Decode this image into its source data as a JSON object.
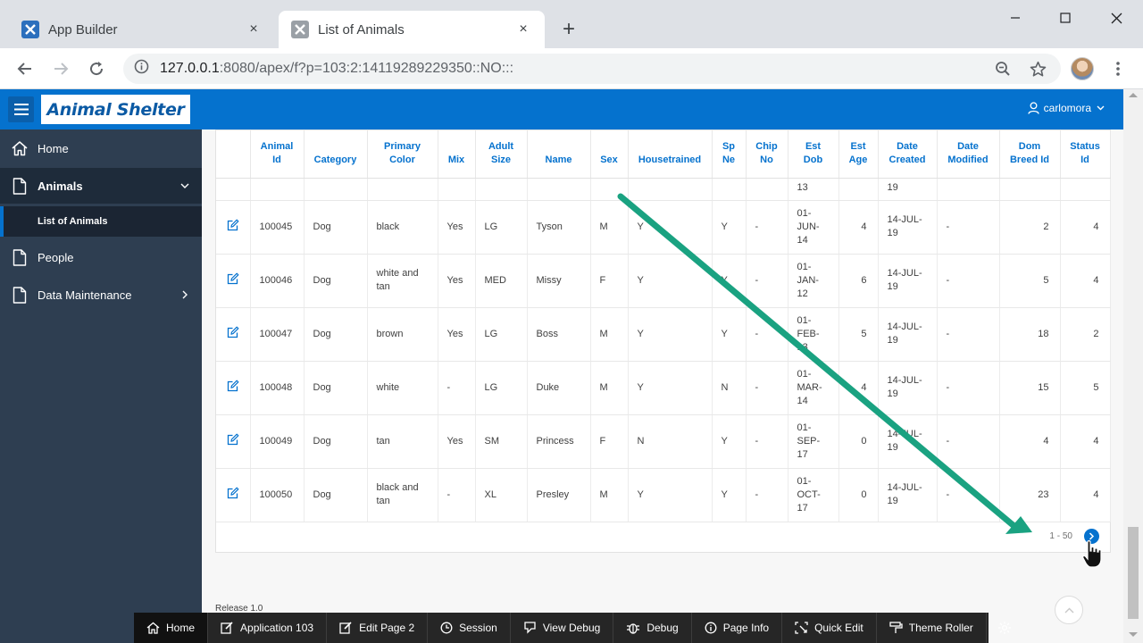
{
  "browser": {
    "tabs": [
      {
        "title": "App Builder",
        "close": "×"
      },
      {
        "title": "List of Animals",
        "close": "×"
      }
    ],
    "new_tab": "+",
    "url_host": "127.0.0.1",
    "url_rest": ":8080/apex/f?p=103:2:14119289229350::NO:::"
  },
  "app": {
    "logo": "Animal Shelter",
    "user": "carlomora"
  },
  "sidebar": {
    "items": [
      {
        "label": "Home",
        "icon": "home-icon"
      },
      {
        "label": "Animals",
        "icon": "document-icon"
      },
      {
        "label": "People",
        "icon": "document-icon"
      },
      {
        "label": "Data Maintenance",
        "icon": "document-icon"
      }
    ],
    "sub_item": "List of Animals"
  },
  "report": {
    "columns": [
      {
        "l1": "",
        "l2": ""
      },
      {
        "l1": "Animal",
        "l2": "Id"
      },
      {
        "l1": "Category",
        "l2": ""
      },
      {
        "l1": "Primary",
        "l2": "Color"
      },
      {
        "l1": "Mix",
        "l2": ""
      },
      {
        "l1": "Adult",
        "l2": "Size"
      },
      {
        "l1": "Name",
        "l2": ""
      },
      {
        "l1": "Sex",
        "l2": ""
      },
      {
        "l1": "Housetrained",
        "l2": ""
      },
      {
        "l1": "Sp",
        "l2": "Ne"
      },
      {
        "l1": "Chip",
        "l2": "No"
      },
      {
        "l1": "Est",
        "l2": "Dob"
      },
      {
        "l1": "Est",
        "l2": "Age"
      },
      {
        "l1": "Date",
        "l2": "Created"
      },
      {
        "l1": "Date",
        "l2": "Modified"
      },
      {
        "l1": "Dom",
        "l2": "Breed Id"
      },
      {
        "l1": "Status",
        "l2": "Id"
      }
    ],
    "partial_row": {
      "est_dob": "13",
      "date_created": "19"
    },
    "rows": [
      {
        "id": "100045",
        "category": "Dog",
        "color": "black",
        "mix": "Yes",
        "size": "LG",
        "name": "Tyson",
        "sex": "M",
        "housetrained": "Y",
        "spne": "Y",
        "chip": "-",
        "dob": [
          "01-",
          "JUN-",
          "14"
        ],
        "age": "4",
        "created": [
          "14-JUL-",
          "19"
        ],
        "modified": "-",
        "breed": "2",
        "status": "4"
      },
      {
        "id": "100046",
        "category": "Dog",
        "color": "white and tan",
        "mix": "Yes",
        "size": "MED",
        "name": "Missy",
        "sex": "F",
        "housetrained": "Y",
        "spne": "Y",
        "chip": "-",
        "dob": [
          "01-",
          "JAN-",
          "12"
        ],
        "age": "6",
        "created": [
          "14-JUL-",
          "19"
        ],
        "modified": "-",
        "breed": "5",
        "status": "4"
      },
      {
        "id": "100047",
        "category": "Dog",
        "color": "brown",
        "mix": "Yes",
        "size": "LG",
        "name": "Boss",
        "sex": "M",
        "housetrained": "Y",
        "spne": "Y",
        "chip": "-",
        "dob": [
          "01-",
          "FEB-",
          "13"
        ],
        "age": "5",
        "created": [
          "14-JUL-",
          "19"
        ],
        "modified": "-",
        "breed": "18",
        "status": "2"
      },
      {
        "id": "100048",
        "category": "Dog",
        "color": "white",
        "mix": "-",
        "size": "LG",
        "name": "Duke",
        "sex": "M",
        "housetrained": "Y",
        "spne": "N",
        "chip": "-",
        "dob": [
          "01-",
          "MAR-",
          "14"
        ],
        "age": "4",
        "created": [
          "14-JUL-",
          "19"
        ],
        "modified": "-",
        "breed": "15",
        "status": "5"
      },
      {
        "id": "100049",
        "category": "Dog",
        "color": "tan",
        "mix": "Yes",
        "size": "SM",
        "name": "Princess",
        "sex": "F",
        "housetrained": "N",
        "spne": "Y",
        "chip": "-",
        "dob": [
          "01-",
          "SEP-",
          "17"
        ],
        "age": "0",
        "created": [
          "14-JUL-",
          "19"
        ],
        "modified": "-",
        "breed": "4",
        "status": "4"
      },
      {
        "id": "100050",
        "category": "Dog",
        "color": "black and tan",
        "mix": "-",
        "size": "XL",
        "name": "Presley",
        "sex": "M",
        "housetrained": "Y",
        "spne": "Y",
        "chip": "-",
        "dob": [
          "01-",
          "OCT-",
          "17"
        ],
        "age": "0",
        "created": [
          "14-JUL-",
          "19"
        ],
        "modified": "-",
        "breed": "23",
        "status": "4"
      }
    ],
    "pagination": "1 - 50"
  },
  "footer": {
    "release": "Release 1.0"
  },
  "devbar": {
    "items": [
      {
        "label": "Home",
        "icon": "home-icon"
      },
      {
        "label": "Application 103",
        "icon": "edit-icon"
      },
      {
        "label": "Edit Page 2",
        "icon": "edit-icon"
      },
      {
        "label": "Session",
        "icon": "clock-icon"
      },
      {
        "label": "View Debug",
        "icon": "debug-view-icon"
      },
      {
        "label": "Debug",
        "icon": "bug-icon"
      },
      {
        "label": "Page Info",
        "icon": "info-icon"
      },
      {
        "label": "Quick Edit",
        "icon": "quick-edit-icon"
      },
      {
        "label": "Theme Roller",
        "icon": "paint-roller-icon"
      }
    ]
  },
  "colors": {
    "apex_blue": "#0572ce",
    "sidebar": "#2e3e51",
    "arrow": "#1aa281",
    "devbar": "#262626"
  }
}
